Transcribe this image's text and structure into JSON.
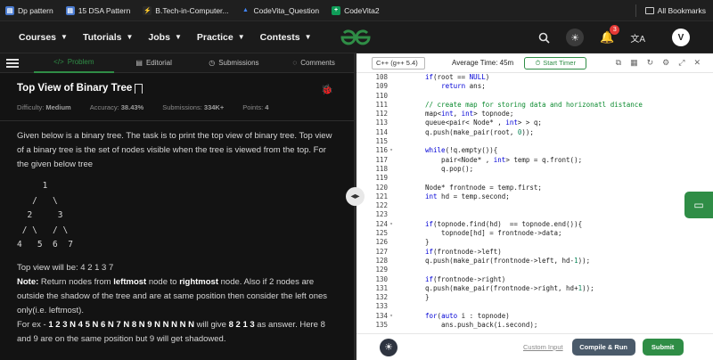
{
  "bookmarks": {
    "items": [
      {
        "label": "Dp pattern",
        "color": "#4a7bd0"
      },
      {
        "label": "15 DSA Pattern",
        "color": "#4a7bd0"
      },
      {
        "label": "B.Tech-in-Computer...",
        "color": "#d4a017"
      },
      {
        "label": "CodeVita_Question",
        "color": "#4285f4"
      },
      {
        "label": "CodeVita2",
        "color": "#0f9d58"
      }
    ],
    "all_label": "All Bookmarks"
  },
  "nav": {
    "links": [
      "Courses",
      "Tutorials",
      "Jobs",
      "Practice",
      "Contests"
    ],
    "notification_count": "3",
    "avatar_letter": "V",
    "brand_color": "#2f8d46"
  },
  "left": {
    "tabs": [
      "Problem",
      "Editorial",
      "Submissions",
      "Comments"
    ],
    "title": "Top View of Binary Tree",
    "meta": {
      "difficulty_label": "Difficulty:",
      "difficulty_value": "Medium",
      "accuracy_label": "Accuracy:",
      "accuracy_value": "38.43%",
      "submissions_label": "Submissions:",
      "submissions_value": "334K+",
      "points_label": "Points:",
      "points_value": "4"
    },
    "description": "Given below is a binary tree. The task is to print the top view of binary tree. Top view of a binary tree is the set of nodes visible when the tree is viewed from the top. For the given below tree",
    "tree_lines": [
      "     1",
      "   /   \\",
      "  2     3",
      " / \\   / \\",
      "4   5  6  7"
    ],
    "top_view_text": "Top view will be: 4 2 1 3 7",
    "note_label": "Note:",
    "note_text_1": " Return nodes from ",
    "note_bold_1": "leftmost",
    "note_text_2": " node to ",
    "note_bold_2": "rightmost",
    "note_text_3": " node. Also if 2 nodes are outside the shadow of the tree and are at same position then consider the left ones only(i.e. leftmost).",
    "ex_text_1": "For ex - ",
    "ex_bold_1": "1 2 3 N 4 5 N 6 N 7 N 8 N 9 N N N N N",
    "ex_text_2": " will give ",
    "ex_bold_2": "8 2 1 3",
    "ex_text_3": " as answer. Here 8 and 9 are on the same position but 9 will get shadowed."
  },
  "editor": {
    "language": "C++ (g++ 5.4)",
    "avg_time": "Average Time: 45m",
    "timer_label": "Start Timer",
    "custom_input": "Custom Input",
    "run_label": "Compile & Run",
    "submit_label": "Submit",
    "lines": [
      {
        "n": "108",
        "fold": "",
        "code": "if(root == NULL)"
      },
      {
        "n": "109",
        "fold": "",
        "code": "    return ans;"
      },
      {
        "n": "110",
        "fold": "",
        "code": ""
      },
      {
        "n": "111",
        "fold": "",
        "code": "// create map for storing data and horizonatl distance"
      },
      {
        "n": "112",
        "fold": "",
        "code": "map<int, int> topnode;"
      },
      {
        "n": "113",
        "fold": "",
        "code": "queue<pair< Node* , int> > q;"
      },
      {
        "n": "114",
        "fold": "",
        "code": "q.push(make_pair(root, 0));"
      },
      {
        "n": "115",
        "fold": "",
        "code": ""
      },
      {
        "n": "116",
        "fold": "▾",
        "code": "while(!q.empty()){"
      },
      {
        "n": "117",
        "fold": "",
        "code": "    pair<Node* , int> temp = q.front();"
      },
      {
        "n": "118",
        "fold": "",
        "code": "    q.pop();"
      },
      {
        "n": "119",
        "fold": "",
        "code": ""
      },
      {
        "n": "120",
        "fold": "",
        "code": "Node* frontnode = temp.first;"
      },
      {
        "n": "121",
        "fold": "",
        "code": "int hd = temp.second;"
      },
      {
        "n": "122",
        "fold": "",
        "code": ""
      },
      {
        "n": "123",
        "fold": "",
        "code": ""
      },
      {
        "n": "124",
        "fold": "▾",
        "code": "if(topnode.find(hd)  == topnode.end()){"
      },
      {
        "n": "125",
        "fold": "",
        "code": "    topnode[hd] = frontnode->data;"
      },
      {
        "n": "126",
        "fold": "",
        "code": "}"
      },
      {
        "n": "127",
        "fold": "",
        "code": "if(frontnode->left)"
      },
      {
        "n": "128",
        "fold": "",
        "code": "q.push(make_pair(frontnode->left, hd-1));"
      },
      {
        "n": "129",
        "fold": "",
        "code": ""
      },
      {
        "n": "130",
        "fold": "",
        "code": "if(frontnode->right)"
      },
      {
        "n": "131",
        "fold": "",
        "code": "q.push(make_pair(frontnode->right, hd+1));"
      },
      {
        "n": "132",
        "fold": "",
        "code": "}"
      },
      {
        "n": "133",
        "fold": "",
        "code": ""
      },
      {
        "n": "134",
        "fold": "▾",
        "code": "for(auto i : topnode)"
      },
      {
        "n": "135",
        "fold": "",
        "code": "    ans.push_back(i.second);"
      }
    ]
  }
}
